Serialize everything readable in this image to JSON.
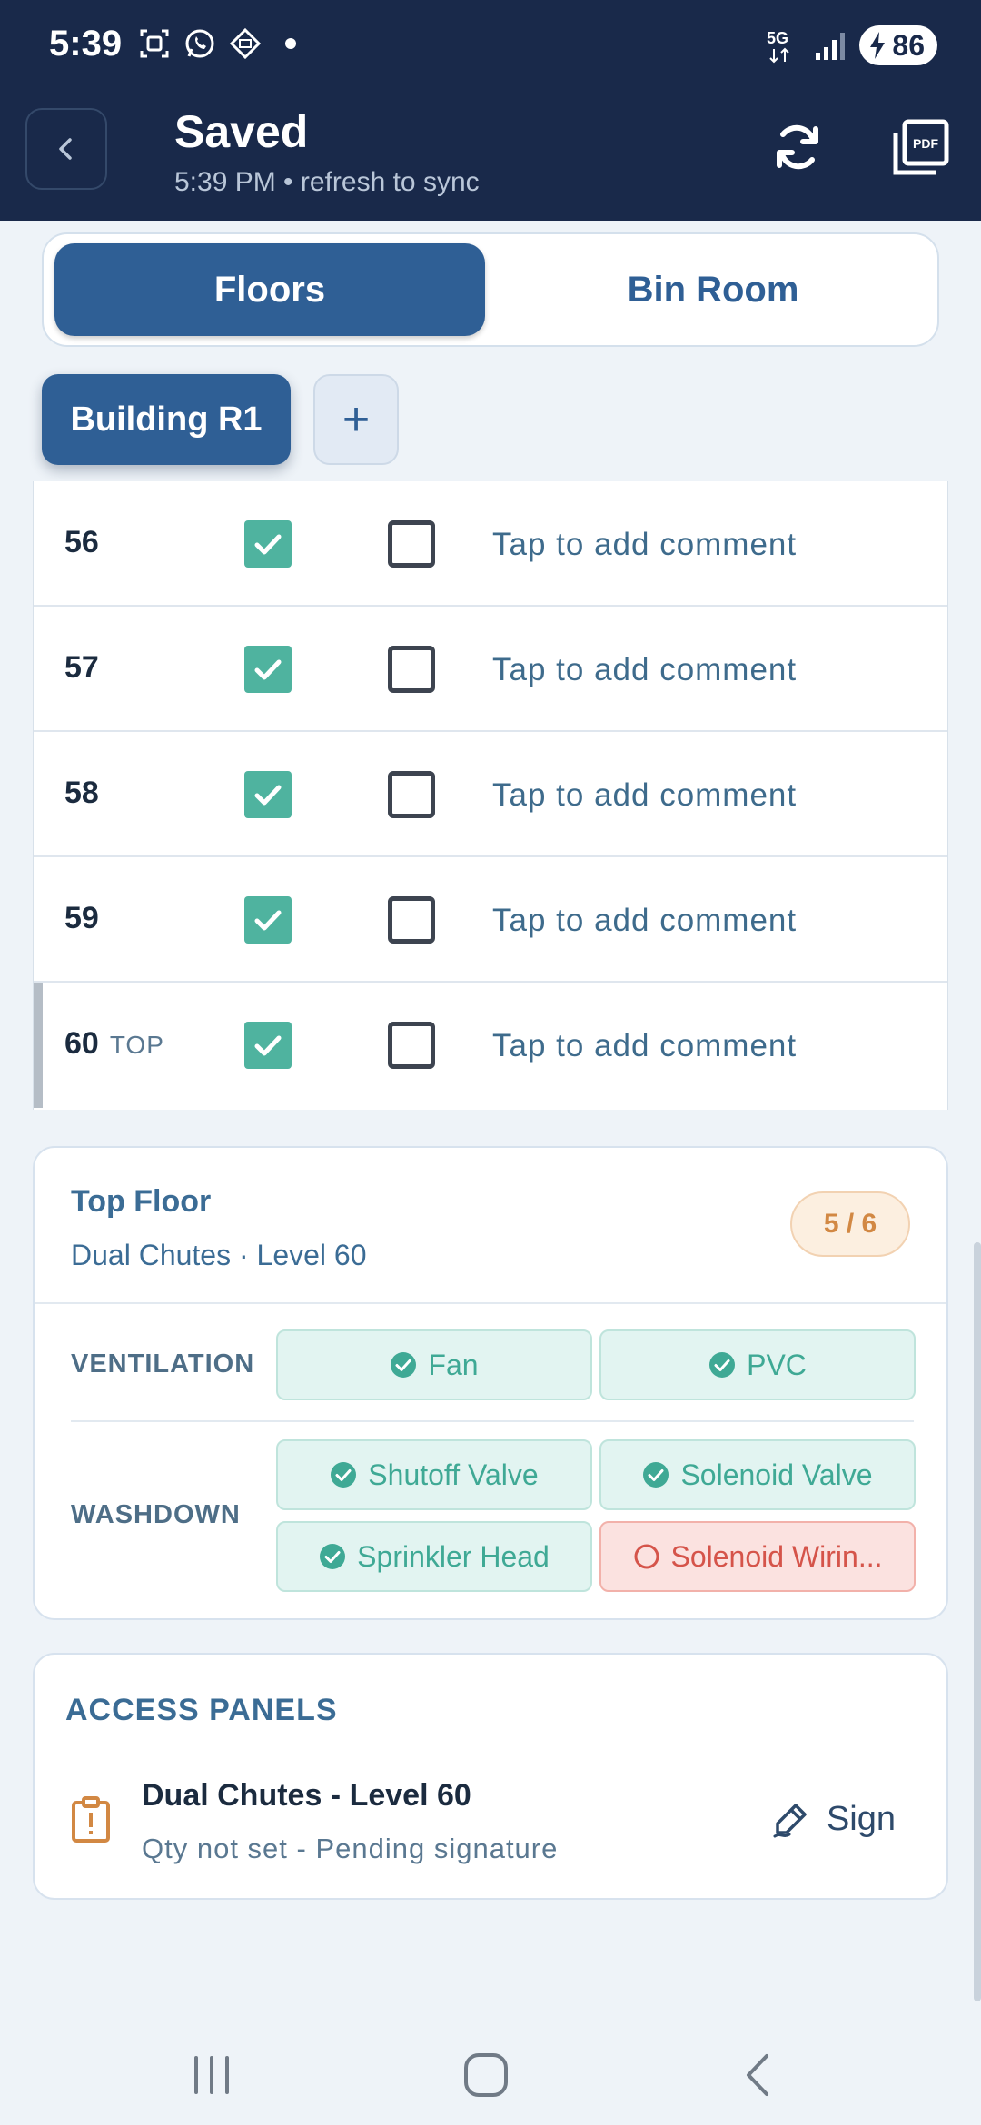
{
  "status_bar": {
    "time": "5:39",
    "network": "5G",
    "battery": "86",
    "icons": [
      "screenshot-icon",
      "whatsapp-icon",
      "app-icon",
      "dot-icon"
    ]
  },
  "header": {
    "title": "Saved",
    "subtitle": "5:39 PM • refresh to sync",
    "icons": [
      "back-icon",
      "sync-icon",
      "pdf-icon"
    ],
    "pdf_label": "PDF"
  },
  "tabs": [
    {
      "label": "Floors",
      "active": true
    },
    {
      "label": "Bin Room",
      "active": false
    }
  ],
  "buildings": {
    "active": "Building R1",
    "add_label": "+"
  },
  "floor_rows": [
    {
      "floor": "56",
      "tag": "",
      "checked_a": true,
      "checked_b": false,
      "comment": "Tap to add comment"
    },
    {
      "floor": "57",
      "tag": "",
      "checked_a": true,
      "checked_b": false,
      "comment": "Tap to add comment"
    },
    {
      "floor": "58",
      "tag": "",
      "checked_a": true,
      "checked_b": false,
      "comment": "Tap to add comment"
    },
    {
      "floor": "59",
      "tag": "",
      "checked_a": true,
      "checked_b": false,
      "comment": "Tap to add comment"
    },
    {
      "floor": "60",
      "tag": "TOP",
      "checked_a": true,
      "checked_b": false,
      "comment": "Tap to add comment"
    }
  ],
  "top_floor": {
    "title": "Top Floor",
    "subtitle": "Dual Chutes · Level 60",
    "progress": "5 / 6",
    "sections": [
      {
        "label": "VENTILATION",
        "items": [
          {
            "label": "Fan",
            "status": "ok"
          },
          {
            "label": "PVC",
            "status": "ok"
          }
        ]
      },
      {
        "label": "WASHDOWN",
        "items": [
          {
            "label": "Shutoff Valve",
            "status": "ok"
          },
          {
            "label": "Solenoid Valve",
            "status": "ok"
          },
          {
            "label": "Sprinkler Head",
            "status": "ok"
          },
          {
            "label": "Solenoid Wirin...",
            "status": "missing"
          }
        ]
      }
    ],
    "colors": {
      "ok": "#3fa995",
      "missing": "#d5544a",
      "badge": "#d28843"
    }
  },
  "access_panels": {
    "title": "ACCESS PANELS",
    "item_name": "Dual Chutes - Level 60",
    "item_status": "Qty not set - Pending signature",
    "sign_label": "Sign"
  },
  "nav_bar": {
    "icons": [
      "recent-apps-icon",
      "home-icon",
      "back-nav-icon"
    ]
  },
  "colors": {
    "header_bg": "#19294a",
    "accent": "#2f5f95",
    "check": "#4fb39f"
  }
}
